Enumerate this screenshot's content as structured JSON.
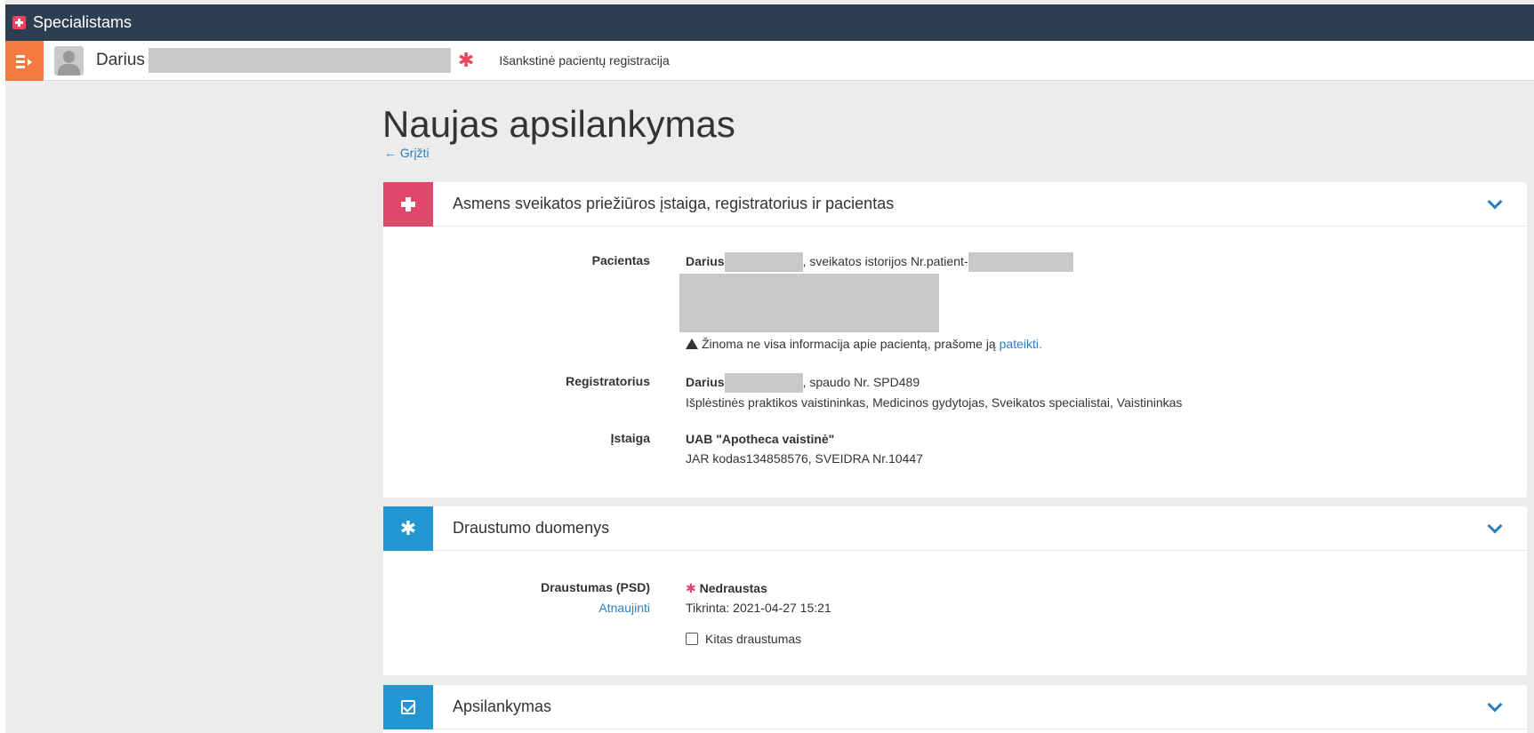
{
  "app": {
    "title": "Specialistams"
  },
  "userbar": {
    "user_first_name": "Darius",
    "prereg_link": "Išankstinė pacientų registracija"
  },
  "page": {
    "title": "Naujas apsilankymas",
    "back_link": "← Grįžti"
  },
  "colors": {
    "topbar": "#2d3e50",
    "menu": "#f47a42",
    "red": "#e0486a",
    "blue": "#2196d3",
    "link": "#2b7fc1"
  },
  "institution_card": {
    "icon": "plus-icon",
    "title": "Asmens sveikatos priežiūros įstaiga, registratorius ir pacientas",
    "patient": {
      "label": "Pacientas",
      "name": "Darius",
      "history_text": ", sveikatos istorijos Nr.patient-",
      "warning_text": "Žinoma ne visa informacija apie pacientą, prašome ją",
      "warning_link": "pateikti."
    },
    "registrar": {
      "label": "Registratorius",
      "name": "Darius",
      "stamp_text": ", spaudo Nr. SPD489",
      "roles": "Išplėstinės praktikos vaistininkas, Medicinos gydytojas, Sveikatos specialistai, Vaistininkas"
    },
    "institution": {
      "label": "Įstaiga",
      "name": "UAB \"Apotheca vaistinė\"",
      "codes": "JAR kodas134858576, SVEIDRA Nr.10447"
    }
  },
  "insurance_card": {
    "icon": "asterisk-icon",
    "title": "Draustumo duomenys",
    "label": "Draustumas (PSD)",
    "refresh_link": "Atnaujinti",
    "status": "Nedraustas",
    "checked": "Tikrinta: 2021-04-27 15:21",
    "other_insurance_label": "Kitas draustumas"
  },
  "visit_card": {
    "icon": "checkbox-icon",
    "title": "Apsilankymas"
  }
}
